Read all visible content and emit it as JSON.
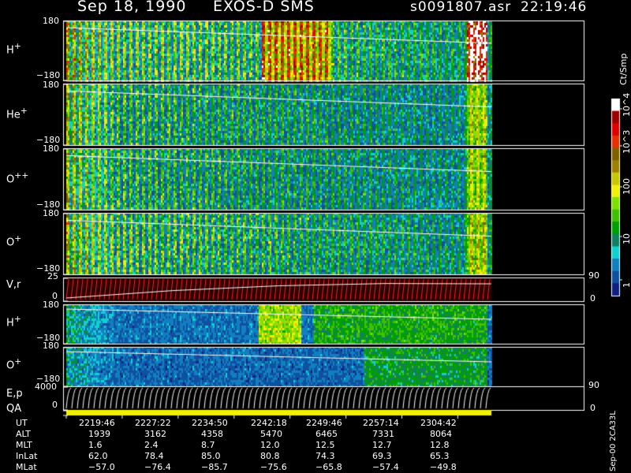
{
  "header": {
    "date": "Sep 18, 1990",
    "instrument": "EXOS-D SMS",
    "file": "s0091807.asr",
    "time": "22:19:46"
  },
  "chart_data": {
    "type": "heatmap",
    "x_ticks": [
      "2219:46",
      "2227:22",
      "2234:50",
      "2242:18",
      "2249:46",
      "2257:14",
      "2304:42"
    ],
    "panels": [
      {
        "label": "H",
        "charge": "+",
        "y_top": "180",
        "y_bottom": "−180"
      },
      {
        "label": "He",
        "charge": "+",
        "y_top": "180",
        "y_bottom": "−180"
      },
      {
        "label": "O",
        "charge": "++",
        "y_top": "180",
        "y_bottom": "−180"
      },
      {
        "label": "O",
        "charge": "+",
        "y_top": "180",
        "y_bottom": "−180"
      },
      {
        "label": "V,r",
        "charge": "",
        "y_top": "25",
        "y_bottom": "0",
        "right_top": "90",
        "right_bottom": "0"
      },
      {
        "label": "H",
        "charge": "+",
        "y_top": "180",
        "y_bottom": "−180"
      },
      {
        "label": "O",
        "charge": "+",
        "y_top": "180",
        "y_bottom": "−180"
      },
      {
        "label": "E,p",
        "charge": "",
        "y_top": "4000",
        "y_bottom": "0",
        "right_top": "90",
        "right_bottom": "0"
      },
      {
        "label": "QA",
        "charge": "",
        "y_top": "",
        "y_bottom": ""
      }
    ],
    "colorbar": {
      "title": "Ct/Smp",
      "ticks": [
        "10^4",
        "10^3",
        "100",
        "10",
        "1"
      ],
      "colors": [
        "#ffffff",
        "#a00000",
        "#e00000",
        "#e83000",
        "#806000",
        "#a08000",
        "#c8c800",
        "#f0f000",
        "#80e000",
        "#40c000",
        "#00a000",
        "#108060",
        "#10d0d0",
        "#1080c0",
        "#1050a0",
        "#102080"
      ]
    },
    "ephemeris": {
      "UT": [
        "2219:46",
        "2227:22",
        "2234:50",
        "2242:18",
        "2249:46",
        "2257:14",
        "2304:42"
      ],
      "ALT": [
        "1939",
        "3162",
        "4358",
        "5470",
        "6465",
        "7331",
        "8064"
      ],
      "MLT": [
        "1.6",
        "2.4",
        "8.7",
        "12.0",
        "12.5",
        "12.7",
        "12.8"
      ],
      "InLat": [
        "62.0",
        "78.4",
        "85.0",
        "80.8",
        "74.3",
        "69.3",
        "65.3"
      ],
      "MLat": [
        "−57.0",
        "−76.4",
        "−85.7",
        "−75.6",
        "−65.8",
        "−57.4",
        "−49.8"
      ]
    }
  },
  "ephemeris_labels": [
    "UT",
    "ALT",
    "MLT",
    "InLat",
    "MLat"
  ],
  "side_note": "Sep-00  2CA33L"
}
